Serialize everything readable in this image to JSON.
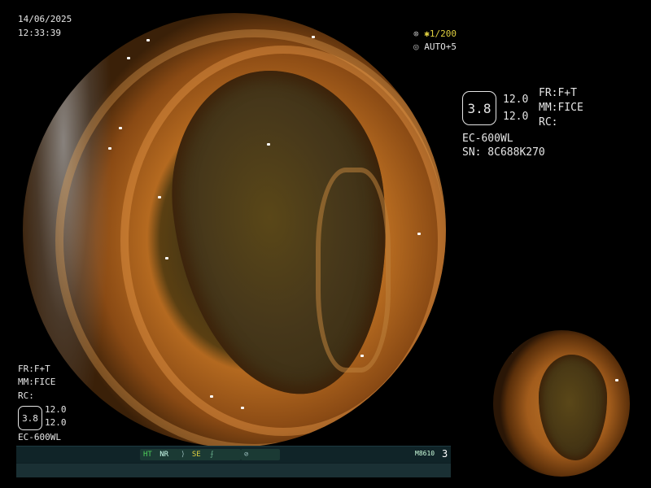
{
  "overlay": {
    "date": "14/06/2025",
    "time": "12:33:39",
    "shutter": "1/200",
    "iris": "AUTO+5",
    "right_panel": {
      "badge_value": "3.8",
      "val1": "12.0",
      "val2": "12.0",
      "fr": "FR:F+T",
      "mm": "MM:FICE",
      "rc": "RC:",
      "scope_model": "EC-600WL",
      "serial": "SN: 8C688K270"
    },
    "left_panel": {
      "fr": "FR:F+T",
      "mm": "MM:FICE",
      "rc": "RC:",
      "badge_value": "3.8",
      "val1": "12.0",
      "val2": "12.0",
      "scope_model": "EC-600WL"
    }
  },
  "status_bar": {
    "ht": "HT",
    "nr": "NR",
    "se": "SE",
    "code": "M8610",
    "number": "3"
  },
  "colors": {
    "mucosa": "#c17a2c",
    "lumen": "#46371a",
    "bar_bg": "#0f2024",
    "ht_green": "#4fd05a",
    "se_yellow": "#e0d040"
  }
}
